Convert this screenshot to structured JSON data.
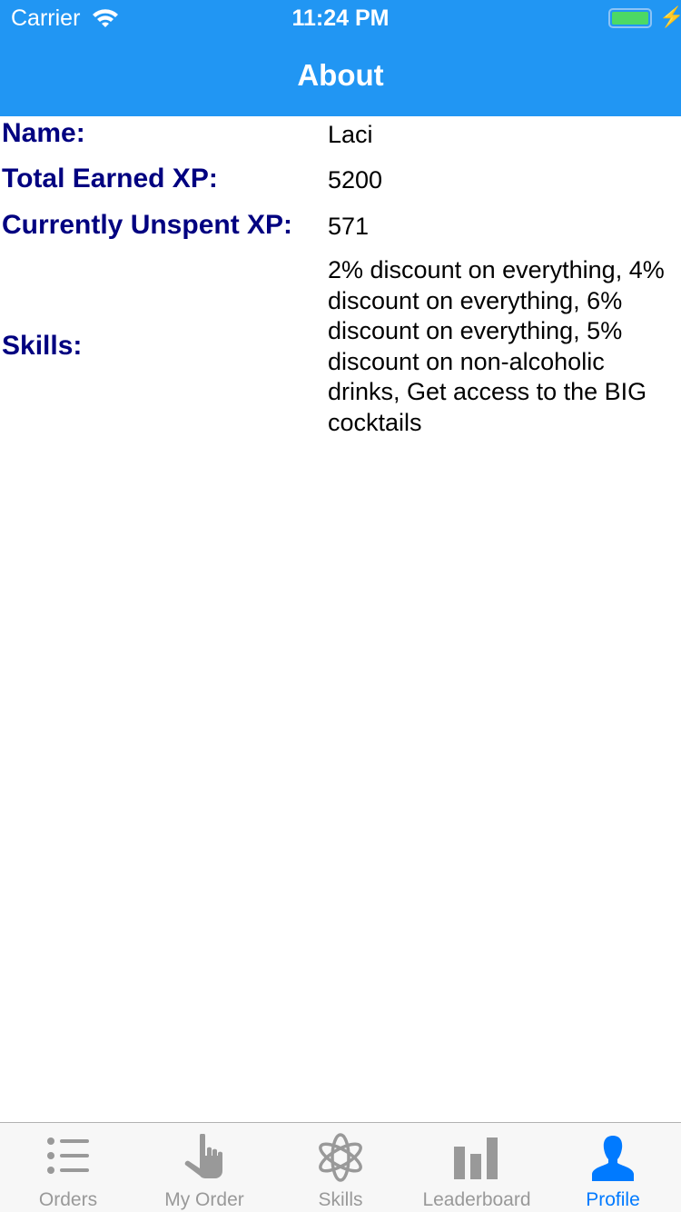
{
  "status_bar": {
    "carrier": "Carrier",
    "time": "11:24 PM"
  },
  "header": {
    "title": "About"
  },
  "profile": {
    "name_label": "Name:",
    "name": "Laci",
    "total_label": "Total Earned XP:",
    "total": "5200",
    "unspent_label": "Currently Unspent XP:",
    "unspent": "571",
    "skills_label": "Skills:",
    "skills": "2% discount on everything, 4% discount on everything, 6% discount on everything, 5% discount on non-alcoholic drinks, Get access to the BIG cocktails"
  },
  "tabs": [
    {
      "label": "Orders",
      "icon": "list-icon"
    },
    {
      "label": "My Order",
      "icon": "hand-pointer-icon"
    },
    {
      "label": "Skills",
      "icon": "atom-icon"
    },
    {
      "label": "Leaderboard",
      "icon": "bar-chart-icon"
    },
    {
      "label": "Profile",
      "icon": "person-icon",
      "active": true
    }
  ],
  "colors": {
    "header": "#2196F3",
    "label": "#000080",
    "active_tab": "#007AFF",
    "inactive_tab": "#999999"
  }
}
